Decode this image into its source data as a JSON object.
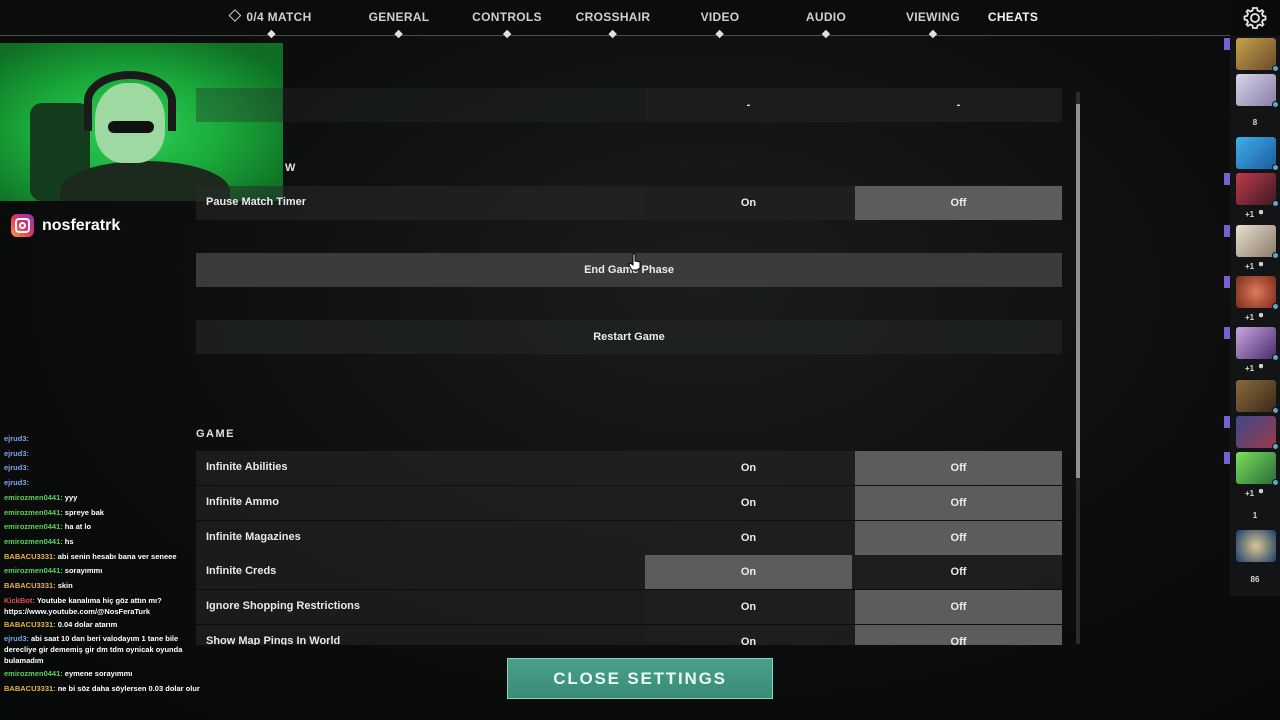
{
  "nav": {
    "match": "0/4 MATCH",
    "tabs": [
      "GENERAL",
      "CONTROLS",
      "CROSSHAIR",
      "VIDEO",
      "AUDIO",
      "VIEWING",
      "CHEATS"
    ]
  },
  "streamer": {
    "instagram": "nosferatrk"
  },
  "settings": {
    "top_row": {
      "on": "-",
      "off": "-"
    },
    "partial_section_suffix": "W",
    "pause_timer": {
      "label": "Pause Match Timer",
      "on": "On",
      "off": "Off"
    },
    "end_game_phase": "End Game Phase",
    "restart_game": "Restart Game",
    "game_section": "GAME",
    "game_rows": [
      {
        "label": "Infinite Abilities",
        "on": "On",
        "off": "Off"
      },
      {
        "label": "Infinite Ammo",
        "on": "On",
        "off": "Off"
      },
      {
        "label": "Infinite Magazines",
        "on": "On",
        "off": "Off"
      },
      {
        "label": "Infinite Creds",
        "on": "On",
        "off": "Off"
      },
      {
        "label": "Ignore Shopping Restrictions",
        "on": "On",
        "off": "Off"
      },
      {
        "label": "Show Map Pings In World",
        "on": "On",
        "off": "Off"
      }
    ]
  },
  "close_button": "CLOSE SETTINGS",
  "chat": [
    {
      "user": "ejrud3:",
      "msg": "",
      "color": "#7aa6e6"
    },
    {
      "user": "ejrud3:",
      "msg": "",
      "color": "#7aa6e6"
    },
    {
      "user": "ejrud3:",
      "msg": "",
      "color": "#7aa6e6"
    },
    {
      "user": "ejrud3:",
      "msg": "",
      "color": "#7aa6e6"
    },
    {
      "user": "emirozmen0441:",
      "msg": "yyy",
      "color": "#5bd15b"
    },
    {
      "user": "emirozmen0441:",
      "msg": "spreye bak",
      "color": "#5bd15b"
    },
    {
      "user": "emirozmen0441:",
      "msg": "ha at lo",
      "color": "#5bd15b"
    },
    {
      "user": "emirozmen0441:",
      "msg": "hs",
      "color": "#5bd15b"
    },
    {
      "user": "BABACU3331:",
      "msg": "abi senin hesabı bana ver seneee",
      "color": "#e8b24a"
    },
    {
      "user": "emirozmen0441:",
      "msg": "sorayımmı",
      "color": "#5bd15b"
    },
    {
      "user": "BABACU3331:",
      "msg": "skin",
      "color": "#e8b24a"
    },
    {
      "user": "KickBot:",
      "msg": "Youtube kanalıma hiç göz attın mı? https://www.youtube.com/@NosFeraTurk",
      "color": "#e05050"
    },
    {
      "user": "BABACU3331:",
      "msg": "0.04 dolar atarım",
      "color": "#e8b24a"
    },
    {
      "user": "ejrud3:",
      "msg": "abi saat 10 dan beri valodayım 1 tane bile derecliye gir dememiş gir dm tdm oynicak oyunda bulamadım",
      "color": "#7aa6e6"
    },
    {
      "user": "emirozmen0441:",
      "msg": "eymene sorayımmı",
      "color": "#5bd15b"
    },
    {
      "user": "BABACU3331:",
      "msg": "ne bi söz daha söylersen 0.03 dolar olur",
      "color": "#e8b24a"
    }
  ],
  "sidebar": {
    "count_1": "8",
    "plus_label": "+1",
    "count_2": "1",
    "count_3": "86"
  }
}
